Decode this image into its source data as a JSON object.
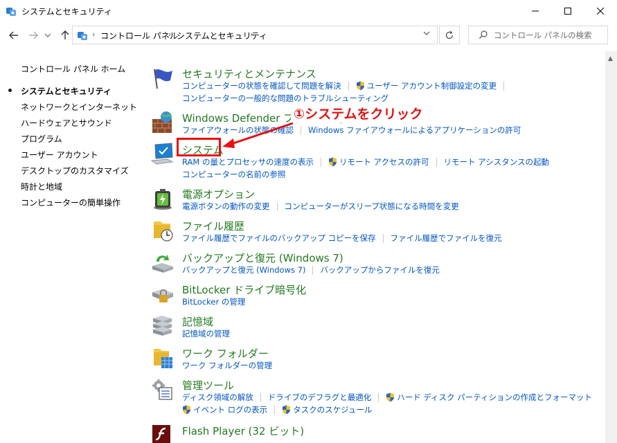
{
  "window": {
    "title": "システムとセキュリティ"
  },
  "address": {
    "crumbs": [
      "コントロール パネル",
      "システムとセキュリティ"
    ],
    "search_placeholder": "コントロール パネルの検索"
  },
  "sidebar": {
    "home": "コントロール パネル ホーム",
    "items": [
      "システムとセキュリティ",
      "ネットワークとインターネット",
      "ハードウェアとサウンド",
      "プログラム",
      "ユーザー アカウント",
      "デスクトップのカスタマイズ",
      "時計と地域",
      "コンピューターの簡単操作"
    ]
  },
  "annotation": {
    "text": "①システムをクリック"
  },
  "categories": [
    {
      "title": "セキュリティとメンテナンス",
      "line1": [
        "コンピューターの状態を確認して問題を解決",
        "ユーザー アカウント制御設定の変更"
      ],
      "line2": [
        "コンピューターの一般的な問題のトラブルシューティング"
      ]
    },
    {
      "title": "Windows Defender ファイアウォール",
      "line1": [
        "ファイアウォールの状態の確認",
        "Windows ファイアウォールによるアプリケーションの許可"
      ]
    },
    {
      "title": "システム",
      "line1": [
        "RAM の量とプロセッサの速度の表示",
        "リモート アクセスの許可",
        "リモート アシスタンスの起動"
      ],
      "line2": [
        "コンピューターの名前の参照"
      ]
    },
    {
      "title": "電源オプション",
      "line1": [
        "電源ボタンの動作の変更",
        "コンピューターがスリープ状態になる時間を変更"
      ]
    },
    {
      "title": "ファイル履歴",
      "line1": [
        "ファイル履歴でファイルのバックアップ コピーを保存",
        "ファイル履歴でファイルを復元"
      ]
    },
    {
      "title": "バックアップと復元 (Windows 7)",
      "line1": [
        "バックアップと復元 (Windows 7)",
        "バックアップからファイルを復元"
      ]
    },
    {
      "title": "BitLocker ドライブ暗号化",
      "line1": [
        "BitLocker の管理"
      ]
    },
    {
      "title": "記憶域",
      "line1": [
        "記憶域の管理"
      ]
    },
    {
      "title": "ワーク フォルダー",
      "line1": [
        "ワーク フォルダーの管理"
      ]
    },
    {
      "title": "管理ツール",
      "line1": [
        "ディスク領域の解放",
        "ドライブのデフラグと最適化",
        "ハード ディスク パーティションの作成とフォーマット"
      ],
      "line2": [
        "イベント ログの表示",
        "タスクのスケジュール"
      ]
    },
    {
      "title": "Flash Player (32 ビット)"
    }
  ],
  "colors": {
    "link": "#0055c9",
    "category": "#217a21",
    "annotation": "#e81010"
  }
}
